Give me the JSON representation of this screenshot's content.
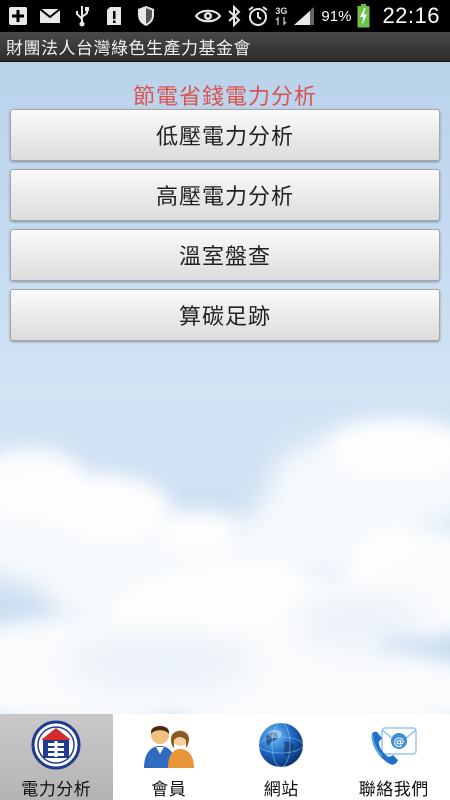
{
  "status_bar": {
    "icons_left": [
      "add-icon",
      "mail-icon",
      "usb-icon",
      "sd-card-alert-icon",
      "shield-icon"
    ],
    "icons_right": [
      "eye-icon",
      "bluetooth-icon",
      "alarm-icon",
      "network-3g-icon",
      "signal-icon"
    ],
    "network_type": "3G",
    "battery_percent": "91%",
    "time": "22:16"
  },
  "app": {
    "title": "財團法人台灣綠色生產力基金會"
  },
  "main": {
    "heading": "節電省錢電力分析",
    "heading_color": "#d9534f",
    "buttons": [
      {
        "label": "低壓電力分析"
      },
      {
        "label": "高壓電力分析"
      },
      {
        "label": "溫室盤查"
      },
      {
        "label": "算碳足跡"
      }
    ]
  },
  "tab_bar": {
    "tabs": [
      {
        "label": "電力分析",
        "icon": "power-analysis-logo-icon",
        "active": true
      },
      {
        "label": "會員",
        "icon": "members-icon",
        "active": false
      },
      {
        "label": "網站",
        "icon": "globe-icon",
        "active": false
      },
      {
        "label": "聯絡我們",
        "icon": "contact-phone-mail-icon",
        "active": false
      }
    ]
  }
}
